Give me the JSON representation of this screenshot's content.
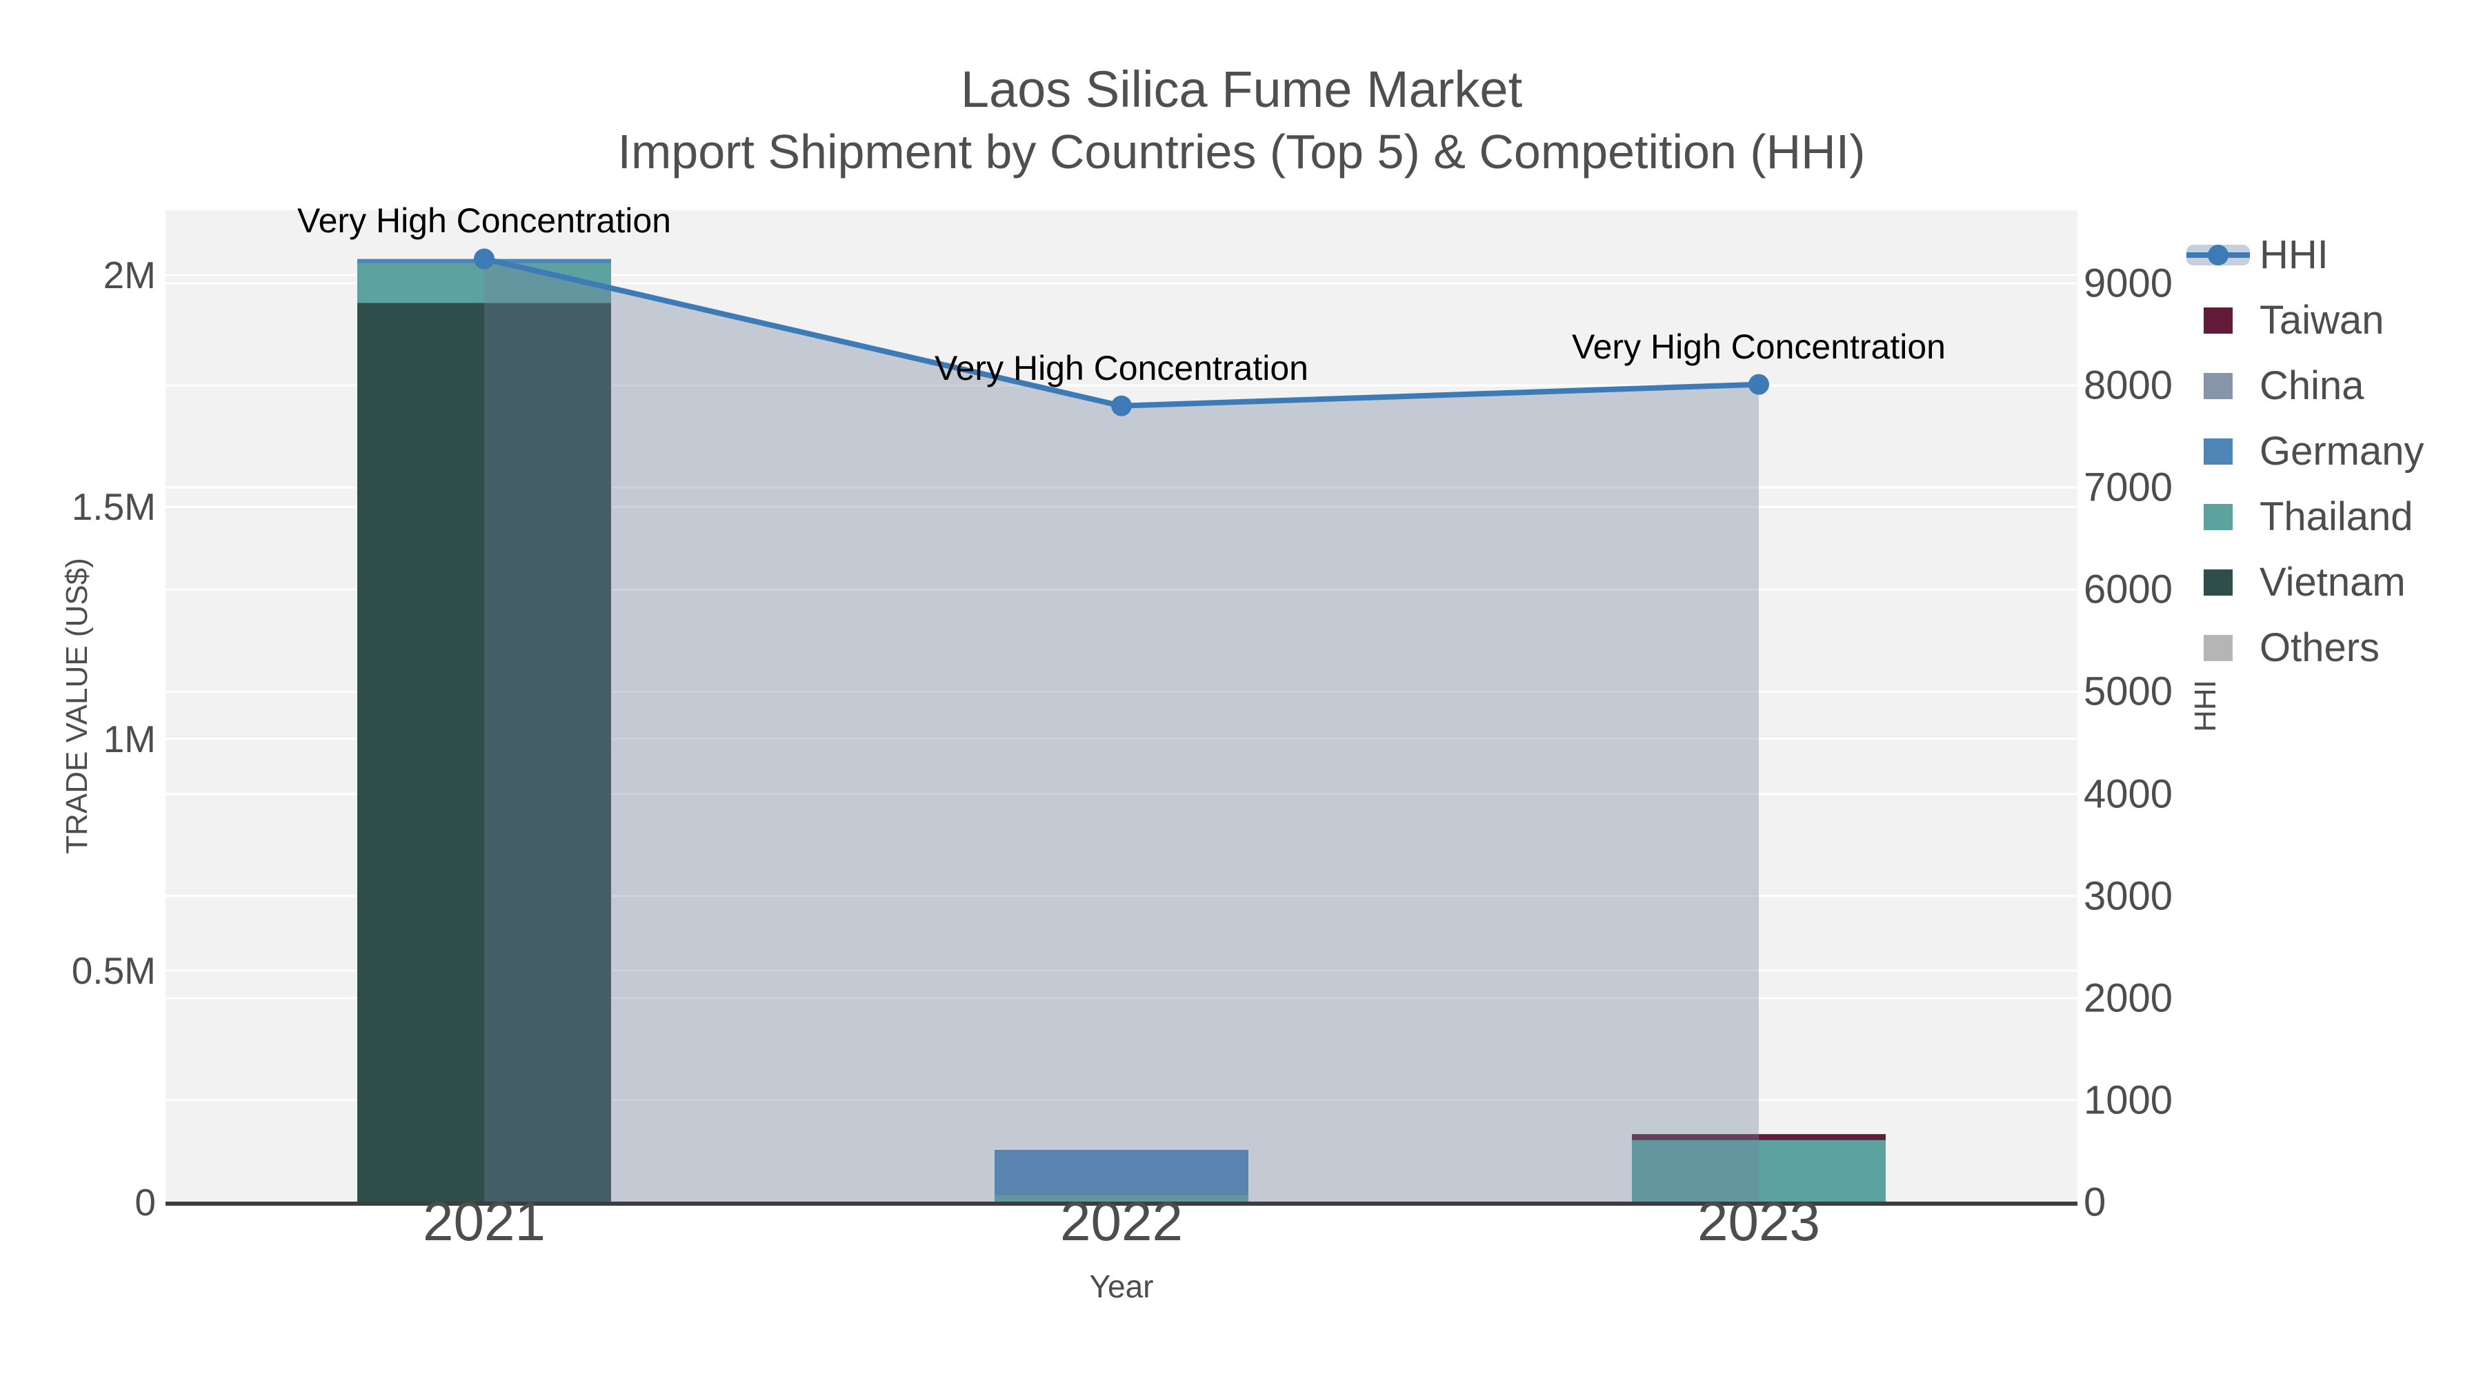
{
  "title": {
    "line1": "Laos Silica Fume Market",
    "line2": "Import Shipment by Countries (Top 5) & Competition (HHI)"
  },
  "colors": {
    "hhi_line": "#3d7bb7",
    "hhi_area_fill": "rgba(113,130,159,0.35)",
    "legend_band": "#c5d0dc",
    "taiwan": "#621c3a",
    "china": "#8795a8",
    "germany": "#4e86b8",
    "thailand": "#5ca29f",
    "vietnam": "#2e4d4b",
    "others": "#b5b5b5",
    "plot_bg": "#f2f2f2",
    "grid": "#ffffff",
    "axis_line": "#3d3d3d",
    "text": "#4d4d4d",
    "annotation": "#000000"
  },
  "legend": {
    "items": [
      {
        "label": "HHI",
        "type": "line",
        "color": "#3d7bb7"
      },
      {
        "label": "Taiwan",
        "type": "swatch",
        "color": "#621c3a"
      },
      {
        "label": "China",
        "type": "swatch",
        "color": "#8795a8"
      },
      {
        "label": "Germany",
        "type": "swatch",
        "color": "#4e86b8"
      },
      {
        "label": "Thailand",
        "type": "swatch",
        "color": "#5ca29f"
      },
      {
        "label": "Vietnam",
        "type": "swatch",
        "color": "#2e4d4b"
      },
      {
        "label": "Others",
        "type": "swatch",
        "color": "#b5b5b5"
      }
    ]
  },
  "chart_data": {
    "type": "bar+line",
    "categories": [
      "2021",
      "2022",
      "2023"
    ],
    "stack_order_bottom_to_top": [
      "Others",
      "Vietnam",
      "Thailand",
      "Germany",
      "China",
      "Taiwan"
    ],
    "series": [
      {
        "name": "Taiwan",
        "color": "#621c3a",
        "values": [
          0,
          0,
          13000
        ]
      },
      {
        "name": "China",
        "color": "#8795a8",
        "values": [
          0,
          0,
          0
        ]
      },
      {
        "name": "Germany",
        "color": "#4e86b8",
        "values": [
          10000,
          98000,
          0
        ]
      },
      {
        "name": "Thailand",
        "color": "#5ca29f",
        "values": [
          85000,
          15000,
          134000
        ]
      },
      {
        "name": "Vietnam",
        "color": "#2e4d4b",
        "values": [
          1940000,
          0,
          0
        ]
      },
      {
        "name": "Others",
        "color": "#b5b5b5",
        "values": [
          0,
          0,
          0
        ]
      }
    ],
    "line_series": {
      "name": "HHI",
      "axis": "right",
      "color": "#3d7bb7",
      "area_fill": "rgba(113,130,159,0.35)",
      "values": [
        9240,
        7800,
        8010
      ]
    },
    "annotations": [
      {
        "text": "Very High Concentration",
        "category": "2021"
      },
      {
        "text": "Very High Concentration",
        "category": "2022"
      },
      {
        "text": "Very High Concentration",
        "category": "2023"
      }
    ],
    "xlabel": "Year",
    "ylabel_left": "TRADE VALUE (US$)",
    "ylabel_right": "HHI",
    "y_left": {
      "max": 2140000,
      "ticks": [
        {
          "label": "0",
          "value": 0
        },
        {
          "label": "0.5M",
          "value": 500000
        },
        {
          "label": "1M",
          "value": 1000000
        },
        {
          "label": "1.5M",
          "value": 1500000
        },
        {
          "label": "2M",
          "value": 2000000
        }
      ]
    },
    "y_right": {
      "max": 9716,
      "ticks": [
        {
          "label": "0",
          "value": 0
        },
        {
          "label": "1000",
          "value": 1000
        },
        {
          "label": "2000",
          "value": 2000
        },
        {
          "label": "3000",
          "value": 3000
        },
        {
          "label": "4000",
          "value": 4000
        },
        {
          "label": "5000",
          "value": 5000
        },
        {
          "label": "6000",
          "value": 6000
        },
        {
          "label": "7000",
          "value": 7000
        },
        {
          "label": "8000",
          "value": 8000
        },
        {
          "label": "9000",
          "value": 9000
        }
      ]
    },
    "grid": true,
    "legend_position": "right"
  }
}
